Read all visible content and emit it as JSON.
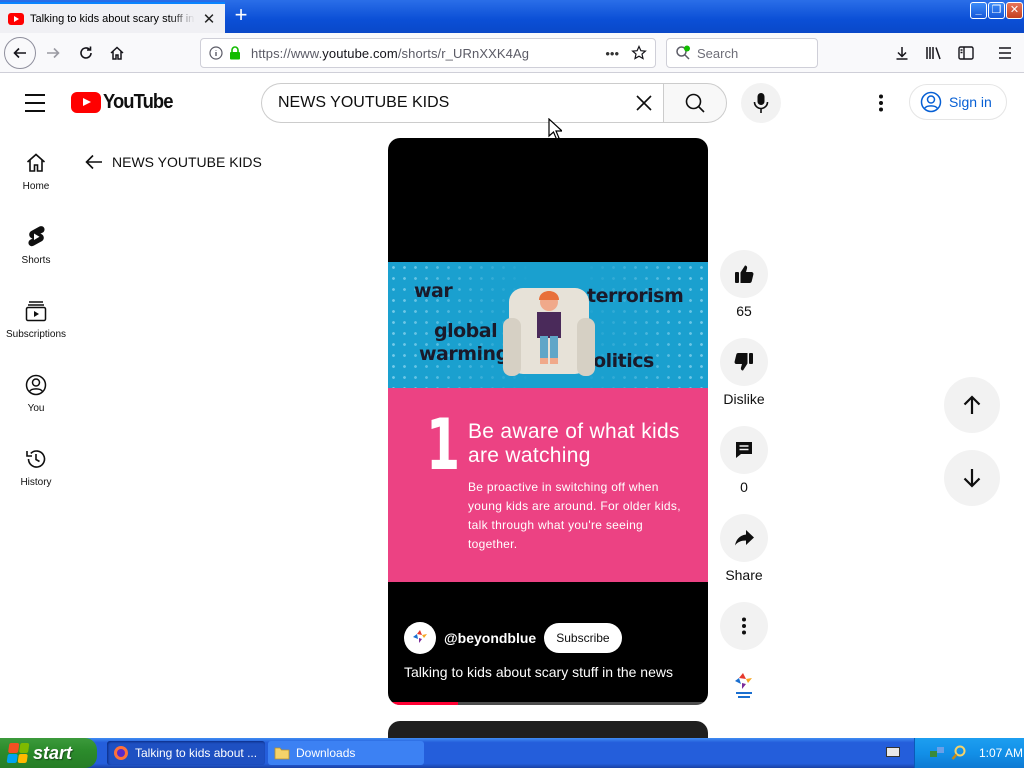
{
  "browser": {
    "tab_title": "Talking to kids about scary stuff in the news",
    "tab_close": "✕",
    "new_tab": "+",
    "url_prefix": "https://www.",
    "url_host": "youtube.com",
    "url_path": "/shorts/r_URnXXK4Ag",
    "url_more": "•••",
    "search_placeholder": "Search"
  },
  "youtube": {
    "logo_text": "YouTube",
    "search_query": "NEWS YOUTUBE KIDS",
    "sign_in": "Sign in",
    "back_query": "NEWS YOUTUBE KIDS",
    "guide": [
      {
        "label": "Home",
        "icon": "home-icon"
      },
      {
        "label": "Shorts",
        "icon": "shorts-icon"
      },
      {
        "label": "Subscriptions",
        "icon": "subscriptions-icon"
      },
      {
        "label": "You",
        "icon": "you-icon"
      },
      {
        "label": "History",
        "icon": "history-icon"
      }
    ]
  },
  "short": {
    "scene_words": {
      "war": "war",
      "terrorism": "terrorism",
      "global": "global",
      "warming": "warming",
      "politics": "politics"
    },
    "tip_number": "1",
    "tip_heading": "Be aware of what kids are watching",
    "tip_body": "Be proactive in switching off when young kids are around. For older kids, talk through what you're seeing together.",
    "channel_handle": "@beyondblue",
    "subscribe": "Subscribe",
    "title": "Talking to kids about scary stuff in the news",
    "progress_fraction": 0.22
  },
  "actions": {
    "like_count": "65",
    "dislike": "Dislike",
    "comment_count": "0",
    "share": "Share"
  },
  "taskbar": {
    "start": "start",
    "task_browser": "Talking to kids about ...",
    "task_folder": "Downloads",
    "clock": "1:07 AM"
  },
  "colors": {
    "youtube_red": "#ff0000",
    "link_blue": "#065fd4",
    "tip_pink": "#ec4283",
    "scene_blue": "#1aa0cf"
  }
}
